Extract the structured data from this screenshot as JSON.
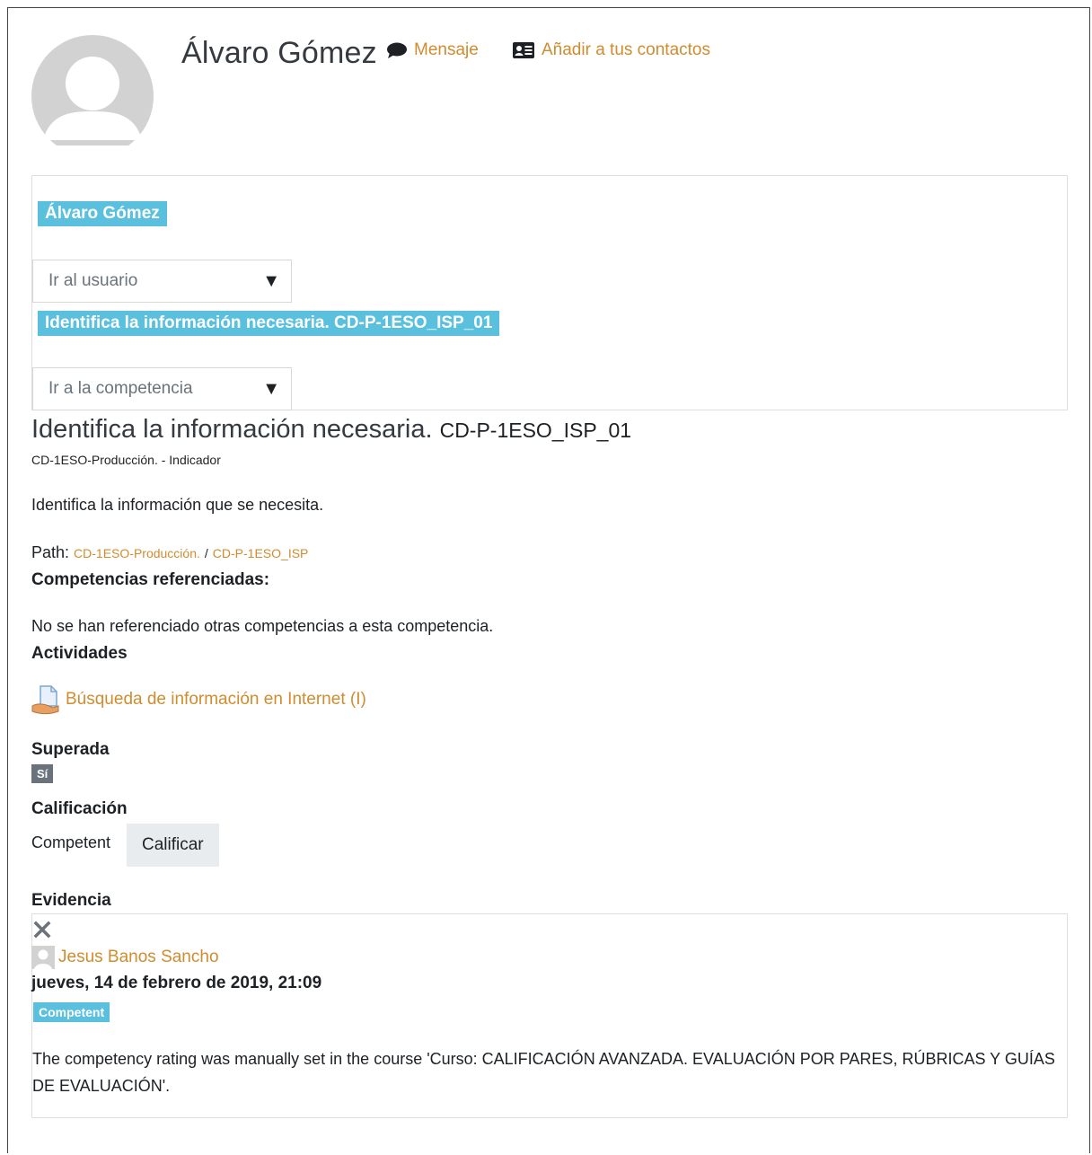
{
  "user": {
    "name": "Álvaro Gómez",
    "message_label": "Mensaje",
    "add_contact_label": "Añadir a tus contactos"
  },
  "nav": {
    "user_pill": "Álvaro Gómez",
    "user_select_placeholder": "Ir al usuario",
    "competency_pill": "Identifica la información necesaria. CD-P-1ESO_ISP_01",
    "competency_select_placeholder": "Ir a la competencia"
  },
  "competency": {
    "title": "Identifica la información necesaria.",
    "idnumber": "CD-P-1ESO_ISP_01",
    "framework": "CD-1ESO-Producción. - Indicador",
    "description": "Identifica la información que se necesita.",
    "path_label": "Path:",
    "path": [
      "CD-1ESO-Producción.",
      "CD-P-1ESO_ISP"
    ],
    "path_sep": "/",
    "related_heading": "Competencias referenciadas:",
    "related_empty": "No se han referenciado otras competencias a esta competencia.",
    "activities_heading": "Actividades",
    "activity_link": "Búsqueda de información en Internet (I)",
    "proficient_heading": "Superada",
    "proficient_badge": "Sí",
    "rating_heading": "Calificación",
    "rating_value": "Competent",
    "rate_button": "Calificar",
    "evidence_heading": "Evidencia"
  },
  "evidence": {
    "author": "Jesus Banos Sancho",
    "date": "jueves, 14 de febrero de 2019, 21:09",
    "badge": "Competent",
    "note": "The competency rating was manually set in the course 'Curso: CALIFICACIÓN AVANZADA. EVALUACIÓN POR PARES, RÚBRICAS Y GUÍAS DE EVALUACIÓN'."
  },
  "colors": {
    "link": "#d08c2e",
    "info": "#5bc0de",
    "secondary": "#6a737b"
  },
  "icons": {
    "avatar": "user-avatar-placeholder",
    "message": "speech-bubble-icon",
    "add_contact": "address-card-icon",
    "activity": "assignment-icon",
    "delete": "close-x-icon",
    "author": "user-thumbnail-icon"
  }
}
